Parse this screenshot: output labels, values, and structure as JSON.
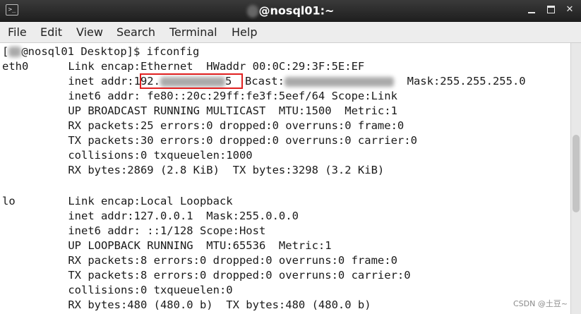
{
  "window": {
    "title": "@nosql01:~",
    "icon": "terminal-icon",
    "minimize_icon": "minimize-icon",
    "maximize_icon": "maximize-icon",
    "close_label": "✕"
  },
  "menu": [
    {
      "label": "File"
    },
    {
      "label": "Edit"
    },
    {
      "label": "View"
    },
    {
      "label": "Search"
    },
    {
      "label": "Terminal"
    },
    {
      "label": "Help"
    }
  ],
  "terminal": {
    "prompt_open": "[",
    "prompt_rest": "@nosql01 Desktop]$ ifconfig",
    "lines": {
      "l1": "eth0      Link encap:Ethernet  HWaddr 00:0C:29:3F:5E:EF",
      "l2_a": "          inet addr:192.",
      "l2_b": "5  Bcast:",
      "l2_c": "  Mask:255.255.255.0",
      "l3": "          inet6 addr: fe80::20c:29ff:fe3f:5eef/64 Scope:Link",
      "l4": "          UP BROADCAST RUNNING MULTICAST  MTU:1500  Metric:1",
      "l5": "          RX packets:25 errors:0 dropped:0 overruns:0 frame:0",
      "l6": "          TX packets:30 errors:0 dropped:0 overruns:0 carrier:0",
      "l7": "          collisions:0 txqueuelen:1000",
      "l8": "          RX bytes:2869 (2.8 KiB)  TX bytes:3298 (3.2 KiB)",
      "l9": "",
      "l10": "lo        Link encap:Local Loopback",
      "l11": "          inet addr:127.0.0.1  Mask:255.0.0.0",
      "l12": "          inet6 addr: ::1/128 Scope:Host",
      "l13": "          UP LOOPBACK RUNNING  MTU:65536  Metric:1",
      "l14": "          RX packets:8 errors:0 dropped:0 overruns:0 frame:0",
      "l15": "          TX packets:8 errors:0 dropped:0 overruns:0 carrier:0",
      "l16": "          collisions:0 txqueuelen:0",
      "l17": "          RX bytes:480 (480.0 b)  TX bytes:480 (480.0 b)"
    }
  },
  "watermark": "CSDN @土豆~"
}
